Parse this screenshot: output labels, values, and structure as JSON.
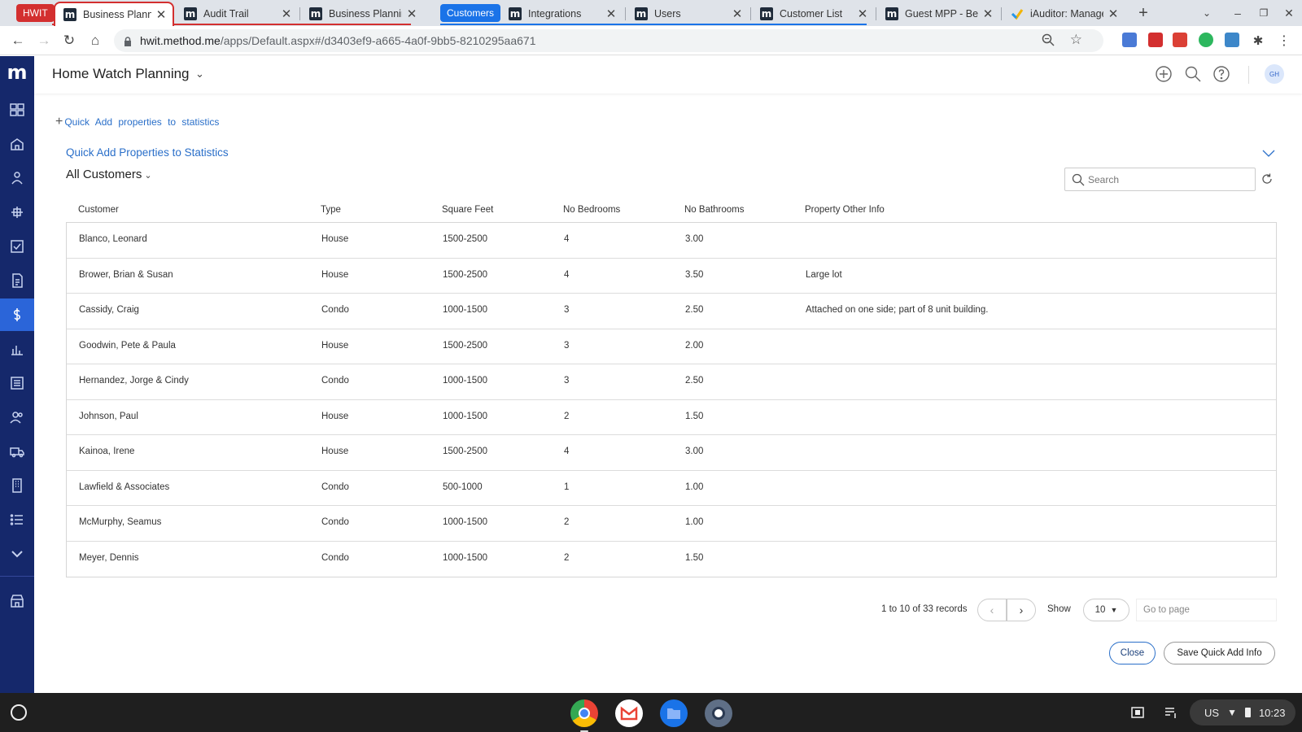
{
  "browser": {
    "tab_groups": [
      {
        "label": "HWIT",
        "color": "#d32f2f"
      },
      {
        "label": "Customers",
        "color": "#1a73e8"
      }
    ],
    "tabs": [
      {
        "title": "Business Planning",
        "icon": "method-logo-icon"
      },
      {
        "title": "Audit Trail",
        "icon": "method-logo-icon"
      },
      {
        "title": "Business Planning",
        "icon": "method-logo-icon"
      },
      {
        "title": "Integrations",
        "icon": "method-logo-icon"
      },
      {
        "title": "Users",
        "icon": "method-logo-icon"
      },
      {
        "title": "Customer List",
        "icon": "method-logo-icon"
      },
      {
        "title": "Guest MPP - Beta",
        "icon": "method-logo-icon"
      },
      {
        "title": "iAuditor: Manage",
        "icon": "iauditor-icon"
      }
    ],
    "url_host": "hwit.method.me",
    "url_path": "/apps/Default.aspx#/d3403ef9-a665-4a0f-9bb5-8210295aa671"
  },
  "app": {
    "logo": "m",
    "title": "Home Watch Planning",
    "avatar_initials": "GH",
    "accent_color": "#2a6fc9",
    "sidebar_color": "#15286b"
  },
  "content": {
    "quick_link": "Quick Add properties to statistics",
    "section_title": "Quick Add Properties to Statistics",
    "view_name": "All Customers",
    "search_placeholder": "Search",
    "columns": [
      "Customer",
      "Type",
      "Square Feet",
      "No Bedrooms",
      "No Bathrooms",
      "Property Other Info"
    ],
    "rows": [
      [
        "Blanco, Leonard",
        "House",
        "1500-2500",
        "4",
        "3.00",
        ""
      ],
      [
        "Brower, Brian & Susan",
        "House",
        "1500-2500",
        "4",
        "3.50",
        "Large lot"
      ],
      [
        "Cassidy, Craig",
        "Condo",
        "1000-1500",
        "3",
        "2.50",
        "Attached on one side; part of 8 unit building."
      ],
      [
        "Goodwin, Pete & Paula",
        "House",
        "1500-2500",
        "3",
        "2.00",
        ""
      ],
      [
        "Hernandez, Jorge & Cindy",
        "Condo",
        "1000-1500",
        "3",
        "2.50",
        ""
      ],
      [
        "Johnson, Paul",
        "House",
        "1000-1500",
        "2",
        "1.50",
        ""
      ],
      [
        "Kainoa, Irene",
        "House",
        "1500-2500",
        "4",
        "3.00",
        ""
      ],
      [
        "Lawfield & Associates",
        "Condo",
        "500-1000",
        "1",
        "1.00",
        ""
      ],
      [
        "McMurphy, Seamus",
        "Condo",
        "1000-1500",
        "2",
        "1.00",
        ""
      ],
      [
        "Meyer, Dennis",
        "Condo",
        "1000-1500",
        "2",
        "1.50",
        ""
      ]
    ],
    "pager_text": "1 to 10 of 33 records",
    "show_label": "Show",
    "page_size": "10",
    "goto_placeholder": "Go to page",
    "close_label": "Close",
    "save_label": "Save Quick Add Info"
  },
  "shelf": {
    "keyboard": "US",
    "time": "10:23"
  }
}
